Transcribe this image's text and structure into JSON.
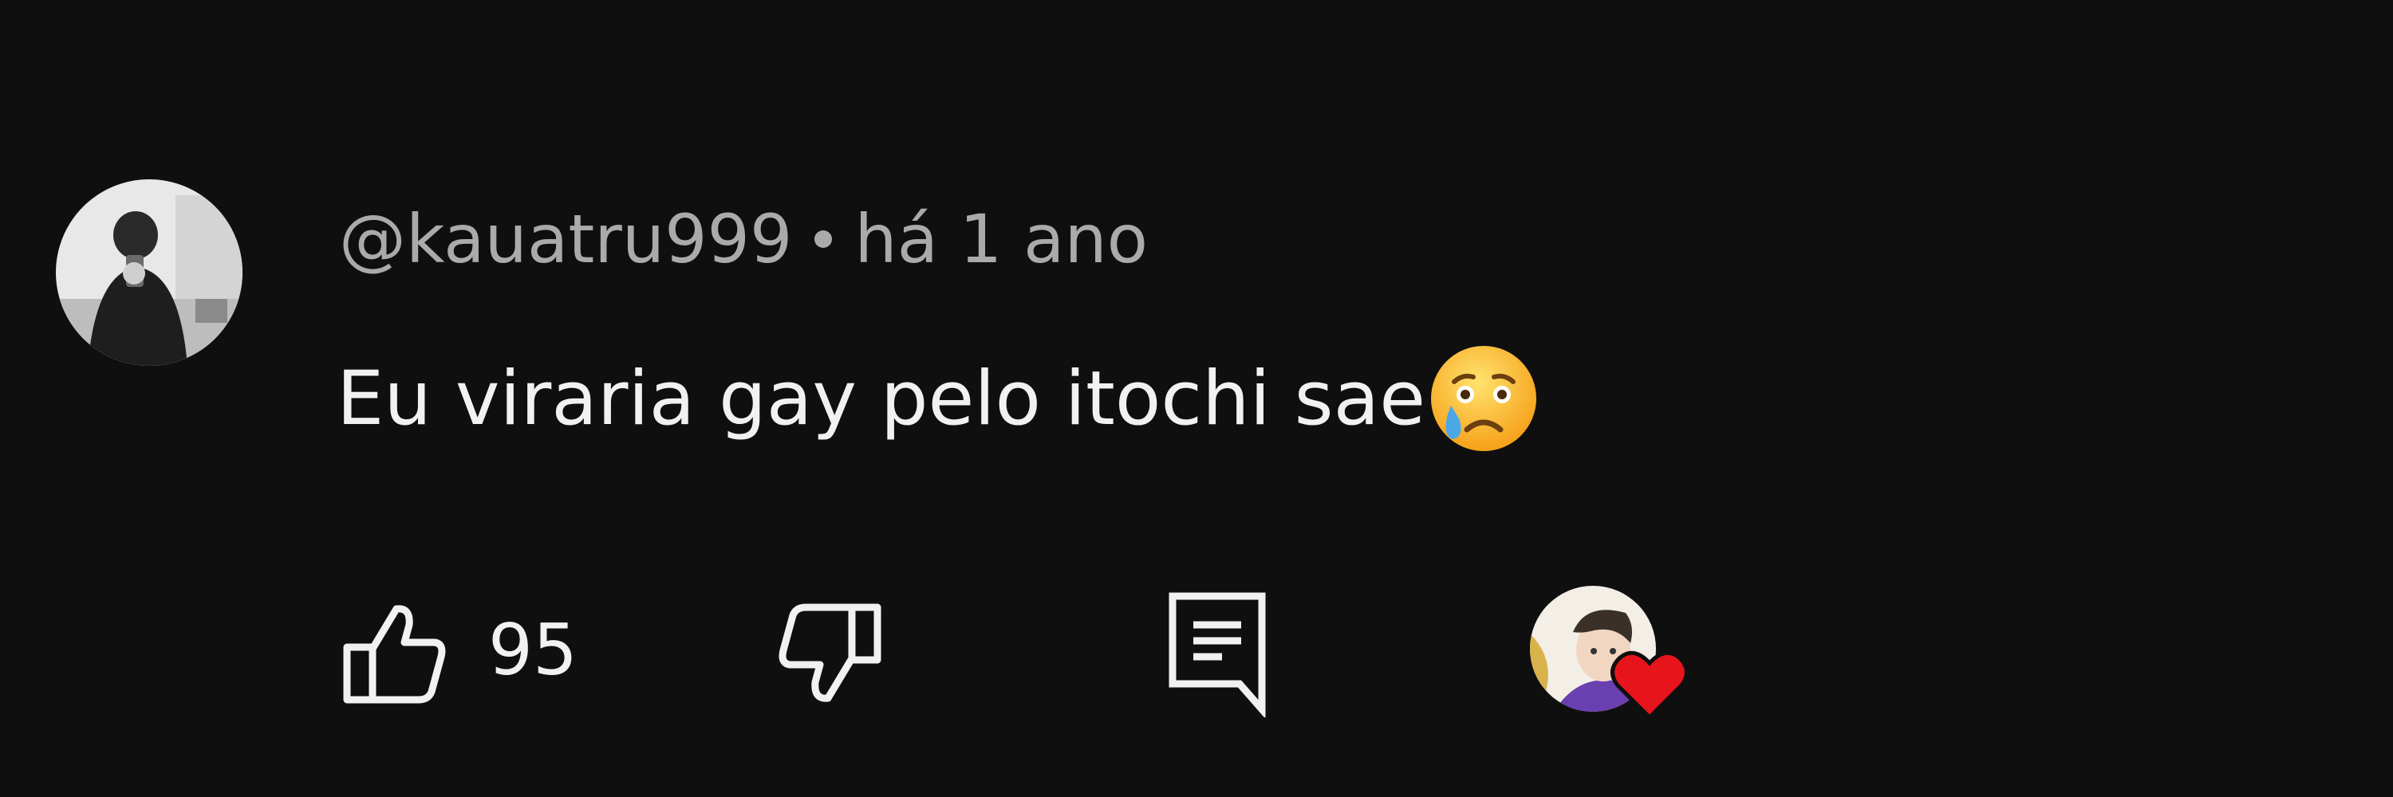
{
  "comment": {
    "author_handle": "@kauatru999",
    "timestamp": "há 1 ano",
    "text": "Eu viraria gay pelo itochi sae",
    "emoji": "crying-face",
    "likes": "95"
  },
  "icons": {
    "avatar": "user-avatar",
    "like": "thumbs-up-icon",
    "dislike": "thumbs-down-icon",
    "reply": "reply-comment-icon",
    "creator_heart": "heart-icon"
  },
  "colors": {
    "background": "#0f0f0f",
    "meta_text": "#aaaaaa",
    "body_text": "#f1f1f1",
    "heart": "#e8141c"
  }
}
